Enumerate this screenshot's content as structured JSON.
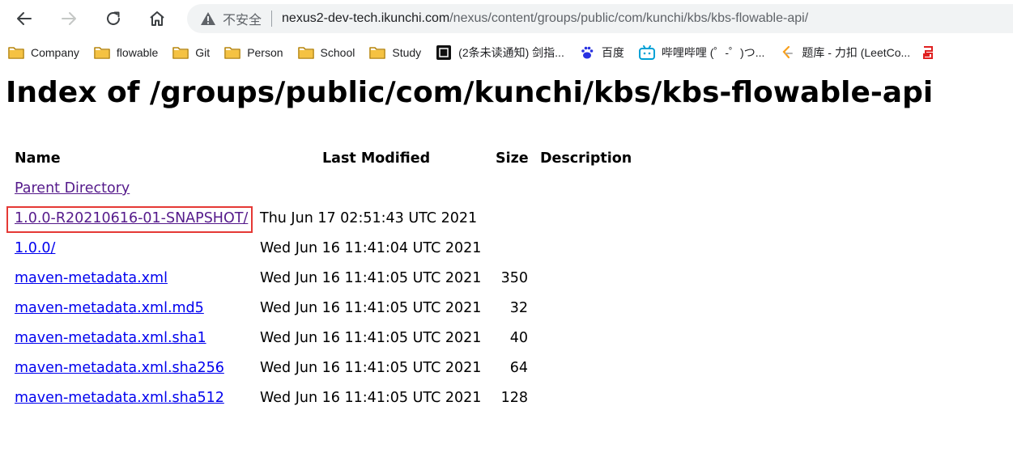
{
  "browser": {
    "security_text": "不安全",
    "url_host": "nexus2-dev-tech.ikunchi.com",
    "url_path": "/nexus/content/groups/public/com/kunchi/kbs/kbs-flowable-api/"
  },
  "bookmarks": [
    {
      "label": "Company",
      "icon": "folder-icon"
    },
    {
      "label": "flowable",
      "icon": "folder-icon"
    },
    {
      "label": "Git",
      "icon": "folder-icon"
    },
    {
      "label": "Person",
      "icon": "folder-icon"
    },
    {
      "label": "School",
      "icon": "folder-icon"
    },
    {
      "label": "Study",
      "icon": "folder-icon"
    },
    {
      "label": "(2条未读通知) 剑指...",
      "icon": "site-icon"
    },
    {
      "label": "百度",
      "icon": "baidu-icon"
    },
    {
      "label": "哔哩哔哩 (゜-゜)つ...",
      "icon": "bilibili-icon"
    },
    {
      "label": "题库 - 力扣 (LeetCo...",
      "icon": "leetcode-icon"
    }
  ],
  "colors": {
    "link": "#0000ee",
    "visited": "#551a8b",
    "highlight": "#e53935",
    "folder": "#f5c242"
  },
  "page": {
    "title": "Index of /groups/public/com/kunchi/kbs/kbs-flowable-api",
    "columns": {
      "name": "Name",
      "modified": "Last Modified",
      "size": "Size",
      "description": "Description"
    },
    "rows": [
      {
        "name": "Parent Directory",
        "modified": "",
        "size": "",
        "visited": true
      },
      {
        "name": "1.0.0-R20210616-01-SNAPSHOT/",
        "modified": "Thu Jun 17 02:51:43 UTC 2021",
        "size": "",
        "visited": true,
        "highlighted": true
      },
      {
        "name": "1.0.0/",
        "modified": "Wed Jun 16 11:41:04 UTC 2021",
        "size": ""
      },
      {
        "name": "maven-metadata.xml",
        "modified": "Wed Jun 16 11:41:05 UTC 2021",
        "size": "350"
      },
      {
        "name": "maven-metadata.xml.md5",
        "modified": "Wed Jun 16 11:41:05 UTC 2021",
        "size": "32"
      },
      {
        "name": "maven-metadata.xml.sha1",
        "modified": "Wed Jun 16 11:41:05 UTC 2021",
        "size": "40"
      },
      {
        "name": "maven-metadata.xml.sha256",
        "modified": "Wed Jun 16 11:41:05 UTC 2021",
        "size": "64"
      },
      {
        "name": "maven-metadata.xml.sha512",
        "modified": "Wed Jun 16 11:41:05 UTC 2021",
        "size": "128"
      }
    ]
  }
}
